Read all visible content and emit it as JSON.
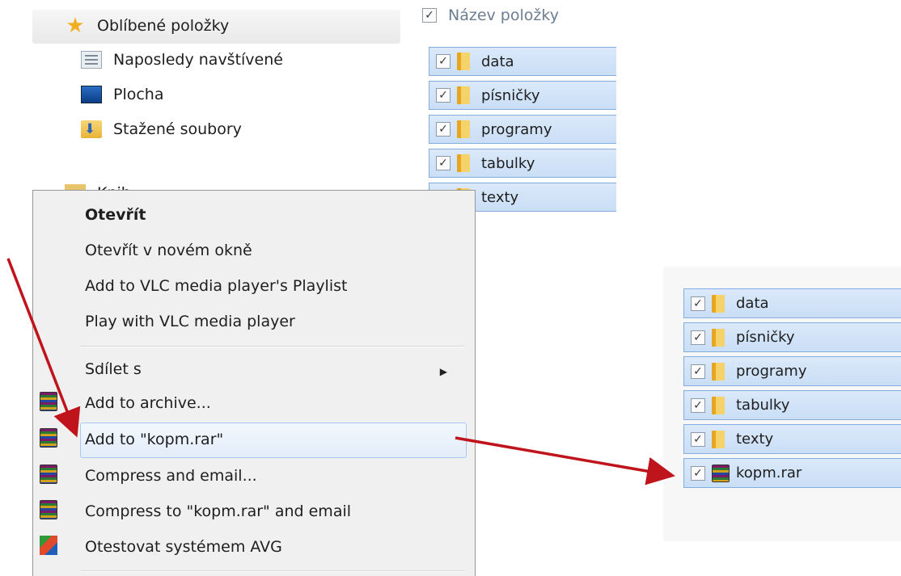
{
  "nav_pane": {
    "favorites_label": "Oblíbené položky",
    "items": [
      {
        "label": "Naposledy navštívené",
        "icon": "recent-places-icon"
      },
      {
        "label": "Plocha",
        "icon": "desktop-icon"
      },
      {
        "label": "Stažené soubory",
        "icon": "downloads-icon"
      }
    ],
    "libraries_label_partial": "Knih"
  },
  "file_pane": {
    "column_header": "Název položky",
    "files": [
      {
        "name": "data",
        "checked": true
      },
      {
        "name": "písničky",
        "checked": true
      },
      {
        "name": "programy",
        "checked": true
      },
      {
        "name": "tabulky",
        "checked": true
      },
      {
        "name": "texty",
        "checked": true
      }
    ]
  },
  "context_menu": {
    "open": "Otevřít",
    "open_new_window": "Otevřít v novém okně",
    "vlc_playlist": "Add to VLC media player's Playlist",
    "vlc_play": "Play with VLC media player",
    "share_with": "Sdílet s",
    "add_archive": "Add to archive...",
    "add_to_rar": "Add to \"kopm.rar\"",
    "compress_email": "Compress and email...",
    "compress_rar_email": "Compress to \"kopm.rar\" and email",
    "avg_scan": "Otestovat systémem AVG",
    "highlighted_item": "add_to_rar"
  },
  "result_pane": {
    "files": [
      {
        "name": "data",
        "type": "folder",
        "checked": true
      },
      {
        "name": "písničky",
        "type": "folder",
        "checked": true
      },
      {
        "name": "programy",
        "type": "folder",
        "checked": true
      },
      {
        "name": "tabulky",
        "type": "folder",
        "checked": true
      },
      {
        "name": "texty",
        "type": "folder",
        "checked": true
      },
      {
        "name": "kopm.rar",
        "type": "rar-archive",
        "checked": true
      }
    ]
  },
  "colors": {
    "selection_fill": "#dbe9fa",
    "selection_border": "#84acdd",
    "arrow": "#c0141c",
    "menu_bg": "#f0f0f0"
  }
}
